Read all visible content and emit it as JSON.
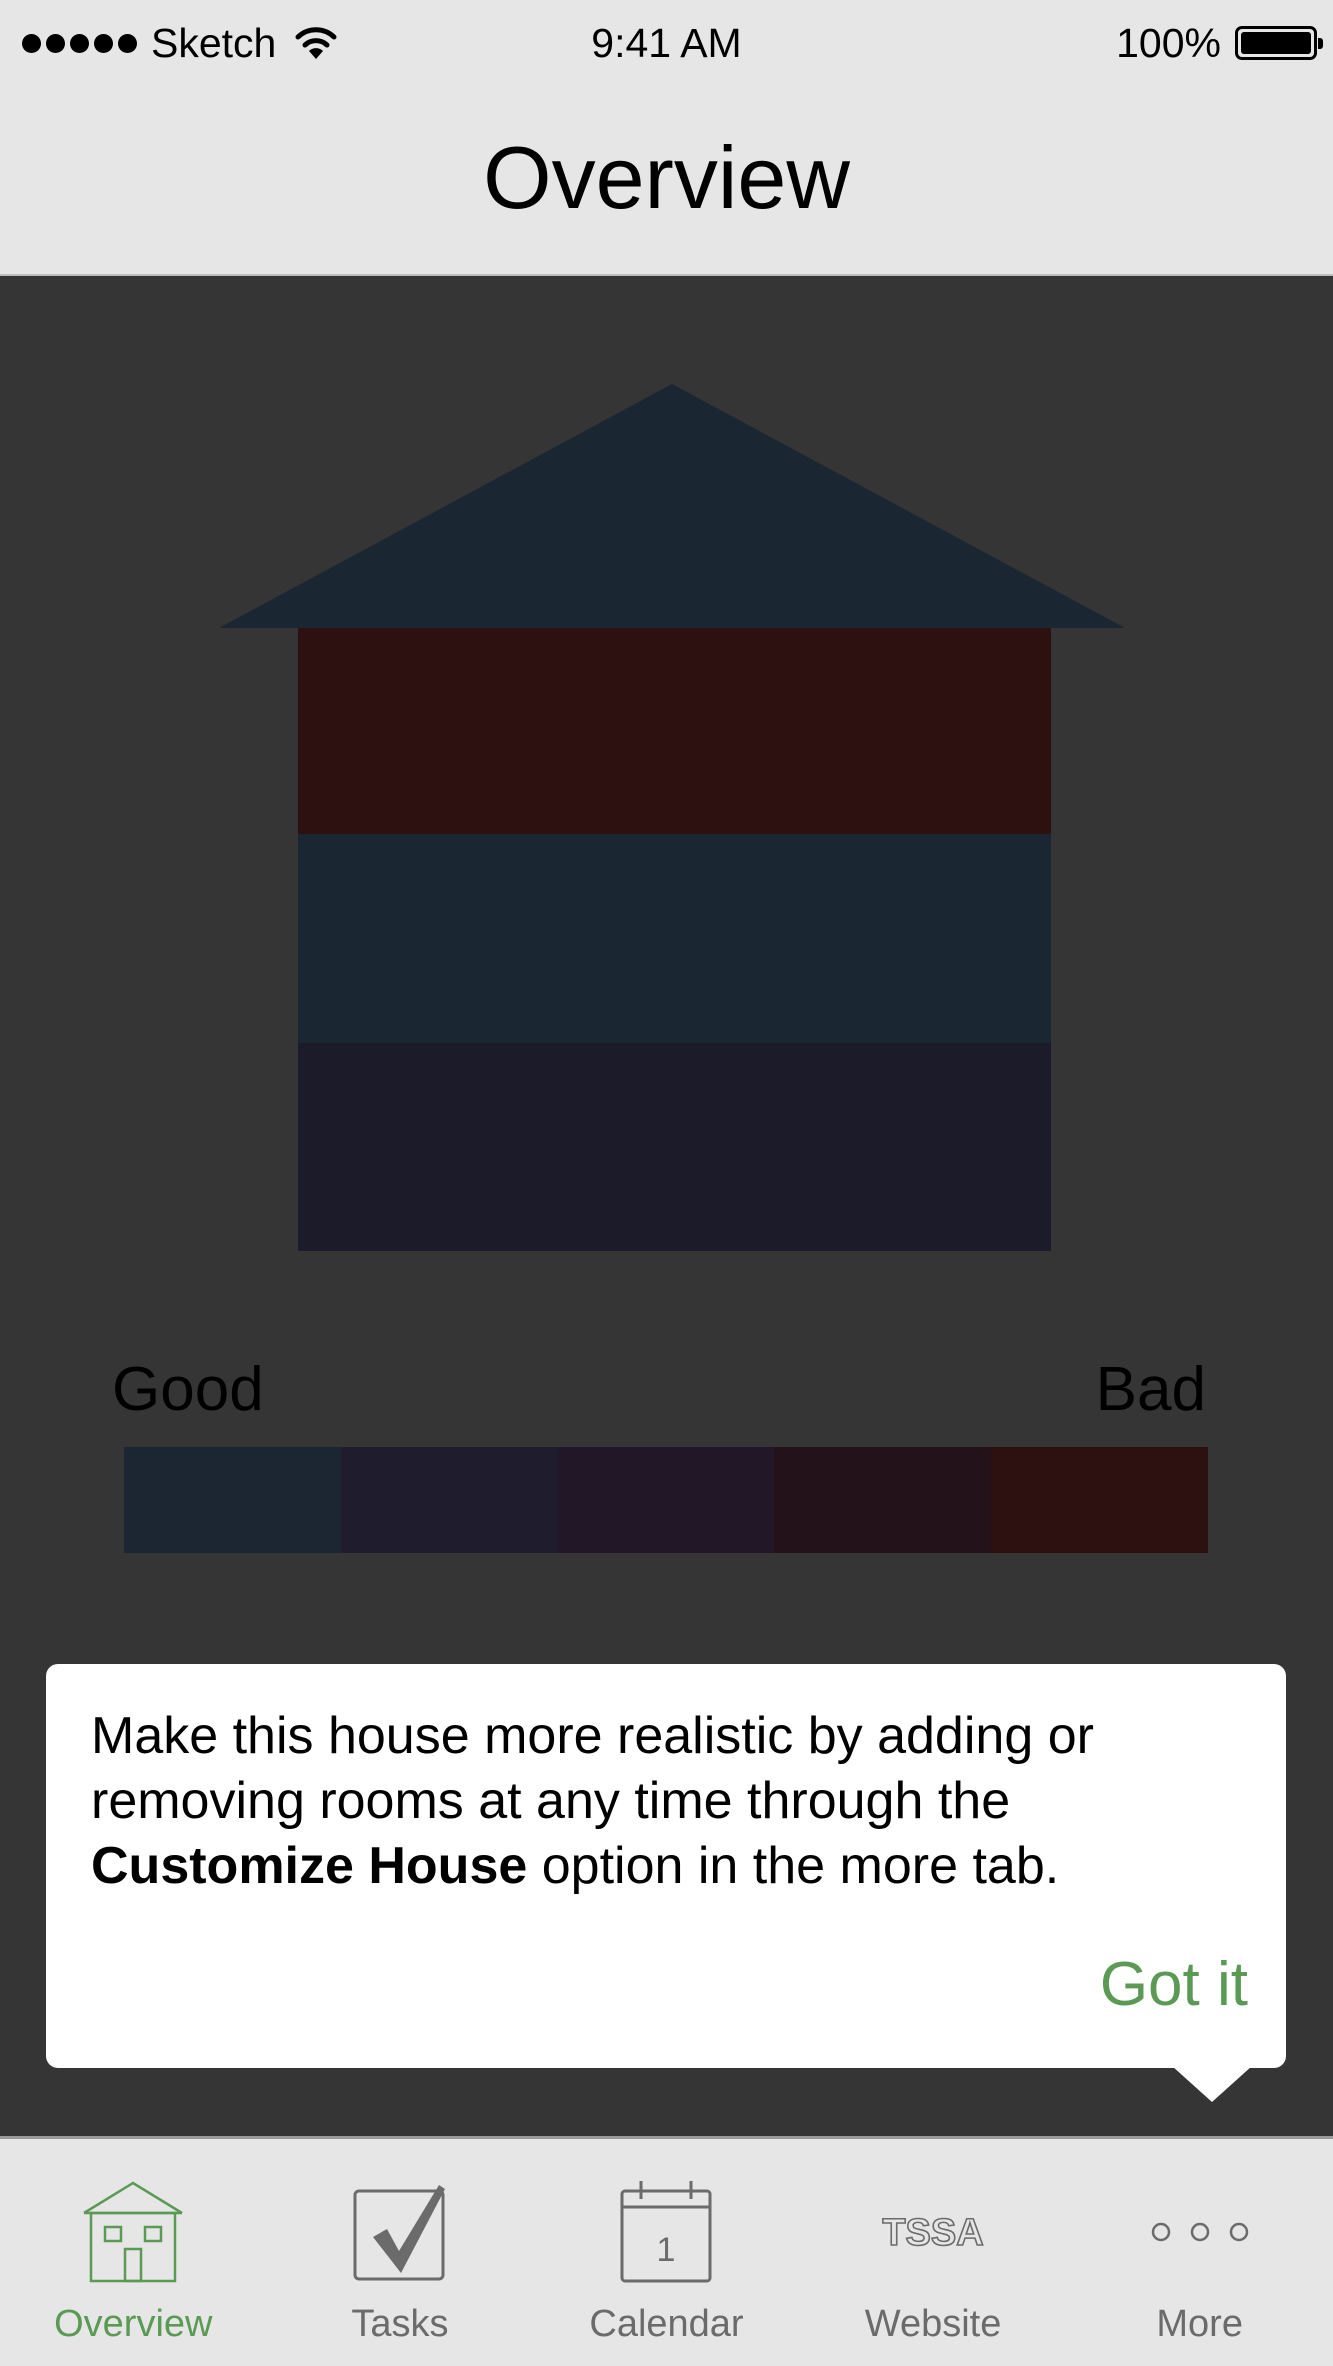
{
  "status_bar": {
    "carrier": "Sketch",
    "time": "9:41 AM",
    "battery": "100%"
  },
  "nav": {
    "title": "Overview"
  },
  "house": {
    "roof_color": "#1a2632",
    "rooms": [
      {
        "color": "#2d1110"
      },
      {
        "color": "#1a2632"
      },
      {
        "color": "#1c1b2a"
      }
    ]
  },
  "scale": {
    "good_label": "Good",
    "bad_label": "Bad",
    "segments": [
      "#1b2632",
      "#1e1c2d",
      "#221727",
      "#24121a",
      "#2d1110"
    ]
  },
  "popover": {
    "text_before": "Make this house more realistic by adding or removing rooms at any time through the ",
    "text_bold": "Customize House",
    "text_after": " option in the more tab.",
    "button_label": "Got it"
  },
  "tab_bar": {
    "accent": "#5a9a55",
    "inactive": "#6b6b6b",
    "tabs": [
      {
        "label": "Overview",
        "icon": "house-icon",
        "active": true
      },
      {
        "label": "Tasks",
        "icon": "checkbox-icon",
        "active": false
      },
      {
        "label": "Calendar",
        "icon": "calendar-icon",
        "active": false,
        "icon_text": "1"
      },
      {
        "label": "Website",
        "icon": "tssa-logo-icon",
        "active": false,
        "icon_text": "TSSA"
      },
      {
        "label": "More",
        "icon": "more-dots-icon",
        "active": false
      }
    ]
  }
}
